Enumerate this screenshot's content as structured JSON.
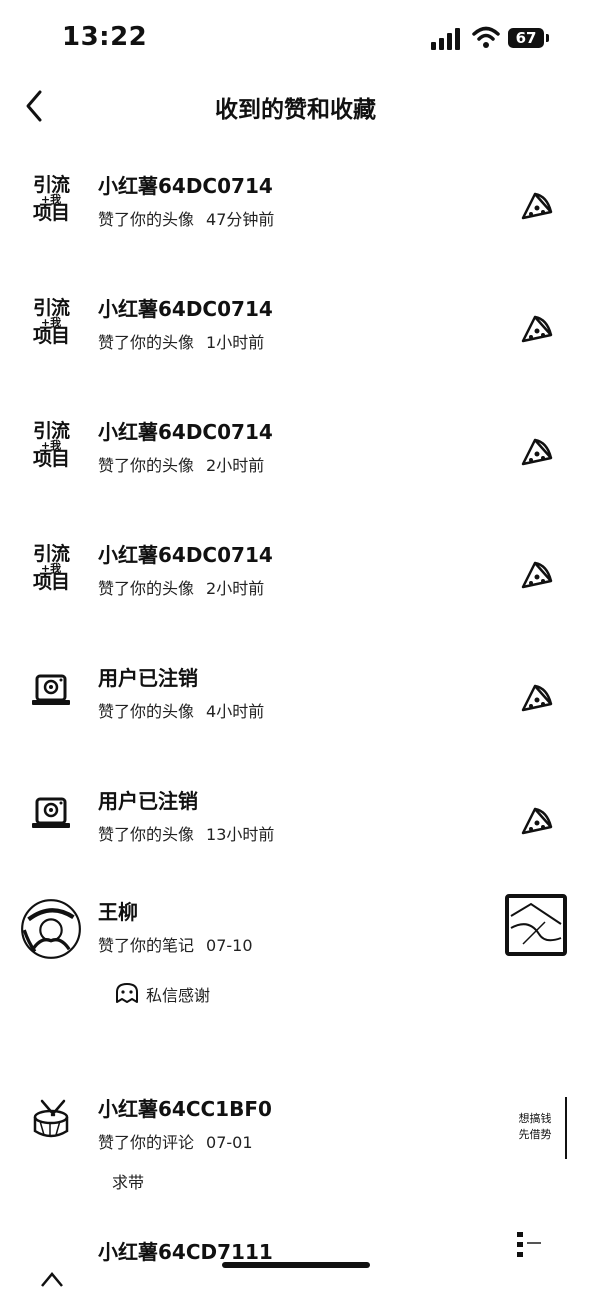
{
  "status_bar": {
    "time": "13:22",
    "battery": "67"
  },
  "header": {
    "title": "收到的赞和收藏"
  },
  "items": [
    {
      "avatar_type": "text-logo",
      "avatar_line1": "引流",
      "avatar_line2": "+我",
      "avatar_line3": "项目",
      "name": "小红薯64DC0714",
      "action": "赞了你的头像",
      "time": "47分钟前",
      "thumb_icon": "pizza-slice-icon"
    },
    {
      "avatar_type": "text-logo",
      "avatar_line1": "引流",
      "avatar_line2": "+我",
      "avatar_line3": "项目",
      "name": "小红薯64DC0714",
      "action": "赞了你的头像",
      "time": "1小时前",
      "thumb_icon": "pizza-slice-icon"
    },
    {
      "avatar_type": "text-logo",
      "avatar_line1": "引流",
      "avatar_line2": "+我",
      "avatar_line3": "项目",
      "name": "小红薯64DC0714",
      "action": "赞了你的头像",
      "time": "2小时前",
      "thumb_icon": "pizza-slice-icon"
    },
    {
      "avatar_type": "text-logo",
      "avatar_line1": "引流",
      "avatar_line2": "+我",
      "avatar_line3": "项目",
      "name": "小红薯64DC0714",
      "action": "赞了你的头像",
      "time": "2小时前",
      "thumb_icon": "pizza-slice-icon"
    },
    {
      "avatar_type": "cancelled-user",
      "name": "用户已注销",
      "action": "赞了你的头像",
      "time": "4小时前",
      "thumb_icon": "pizza-slice-icon"
    },
    {
      "avatar_type": "cancelled-user",
      "name": "用户已注销",
      "action": "赞了你的头像",
      "time": "13小时前",
      "thumb_icon": "pizza-slice-icon"
    },
    {
      "avatar_type": "photo",
      "name": "王柳",
      "action": "赞了你的笔记",
      "time": "07-10",
      "thumb_icon": "note-thumbnail",
      "reply_label": "私信感谢"
    },
    {
      "avatar_type": "drum",
      "name": "小红薯64CC1BF0",
      "action": "赞了你的评论",
      "time": "07-01",
      "thumb_icon": "comment-thumbnail",
      "thumb_text_1": "想搞钱",
      "thumb_text_2": "先借势",
      "comment": "求带"
    },
    {
      "avatar_type": "partial",
      "name": "小红薯64CD7111"
    }
  ]
}
